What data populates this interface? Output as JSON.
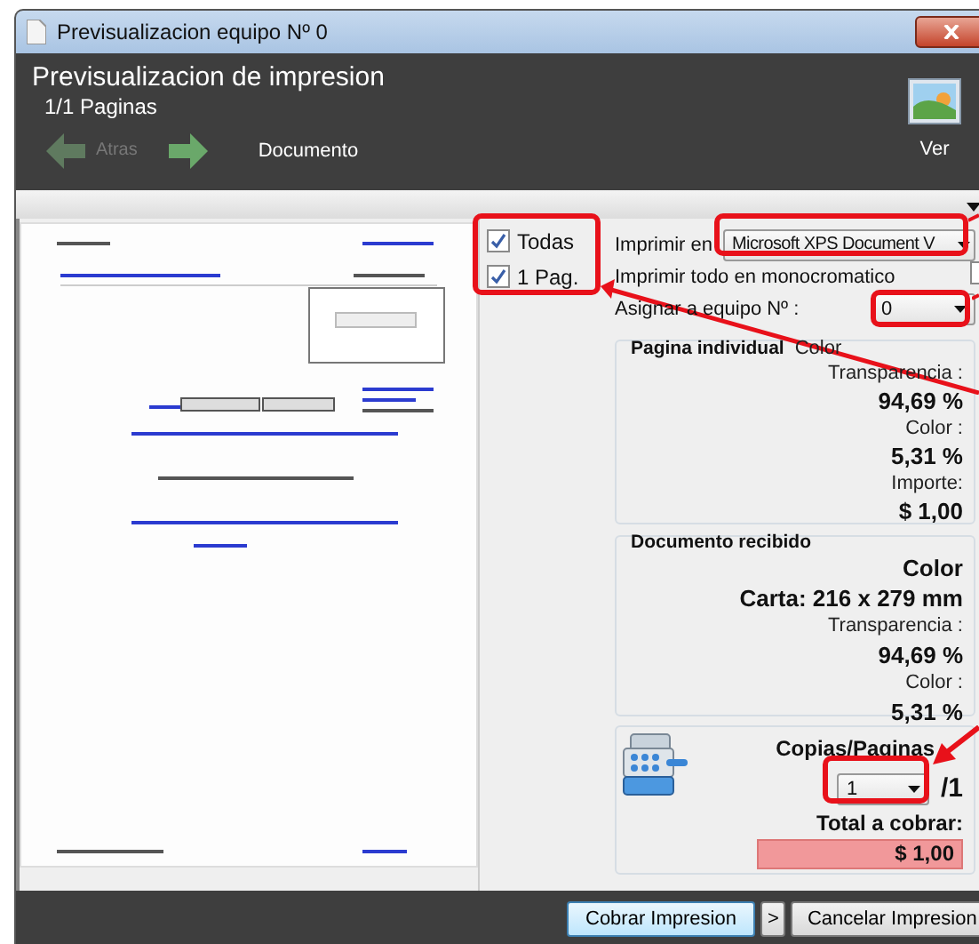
{
  "window": {
    "title": "Previsualizacion equipo Nº 0"
  },
  "header": {
    "title": "Previsualizacion de impresion",
    "pages": "1/1 Paginas",
    "document_link": "Documento",
    "view_button": "Ver"
  },
  "back_button": {
    "label": "Atras",
    "disabled": true
  },
  "forward_button": {
    "disabled": false
  },
  "page_options": [
    {
      "label": "Todas",
      "checked": true
    },
    {
      "label": "1 Pag.",
      "checked": true
    }
  ],
  "print_settings": {
    "printer_label": "Imprimir en",
    "printer": "Microsoft XPS Document V",
    "mono_label": "Imprimir todo en monocromatico",
    "mono_checked": false,
    "assign_label": "Asignar a equipo Nº :",
    "assign_value": "0"
  },
  "single_page": {
    "title": "Pagina individual",
    "mode": "Color",
    "rows": [
      {
        "label": "Transparencia :",
        "value": "94,69 %"
      },
      {
        "label": "Color :",
        "value": "5,31 %"
      },
      {
        "label": "Importe:",
        "value": "$ 1,00"
      }
    ]
  },
  "received": {
    "title": "Documento recibido",
    "mode": "Color",
    "size": "Carta: 216 x 279 mm",
    "rows": [
      {
        "label": "Transparencia :",
        "value": "94,69 %"
      },
      {
        "label": "Color :",
        "value": "5,31 %"
      }
    ]
  },
  "billing": {
    "copies_label": "Copias/Paginas",
    "copies": "1",
    "total_pages": "/1",
    "total_label": "Total a cobrar:",
    "total": "$ 1,00"
  },
  "buttons": [
    {
      "label": "Cobrar Impresion",
      "kind": "primary"
    },
    {
      "label": ">",
      "kind": "small"
    },
    {
      "label": "Cancelar Impresion",
      "kind": "normal"
    }
  ]
}
